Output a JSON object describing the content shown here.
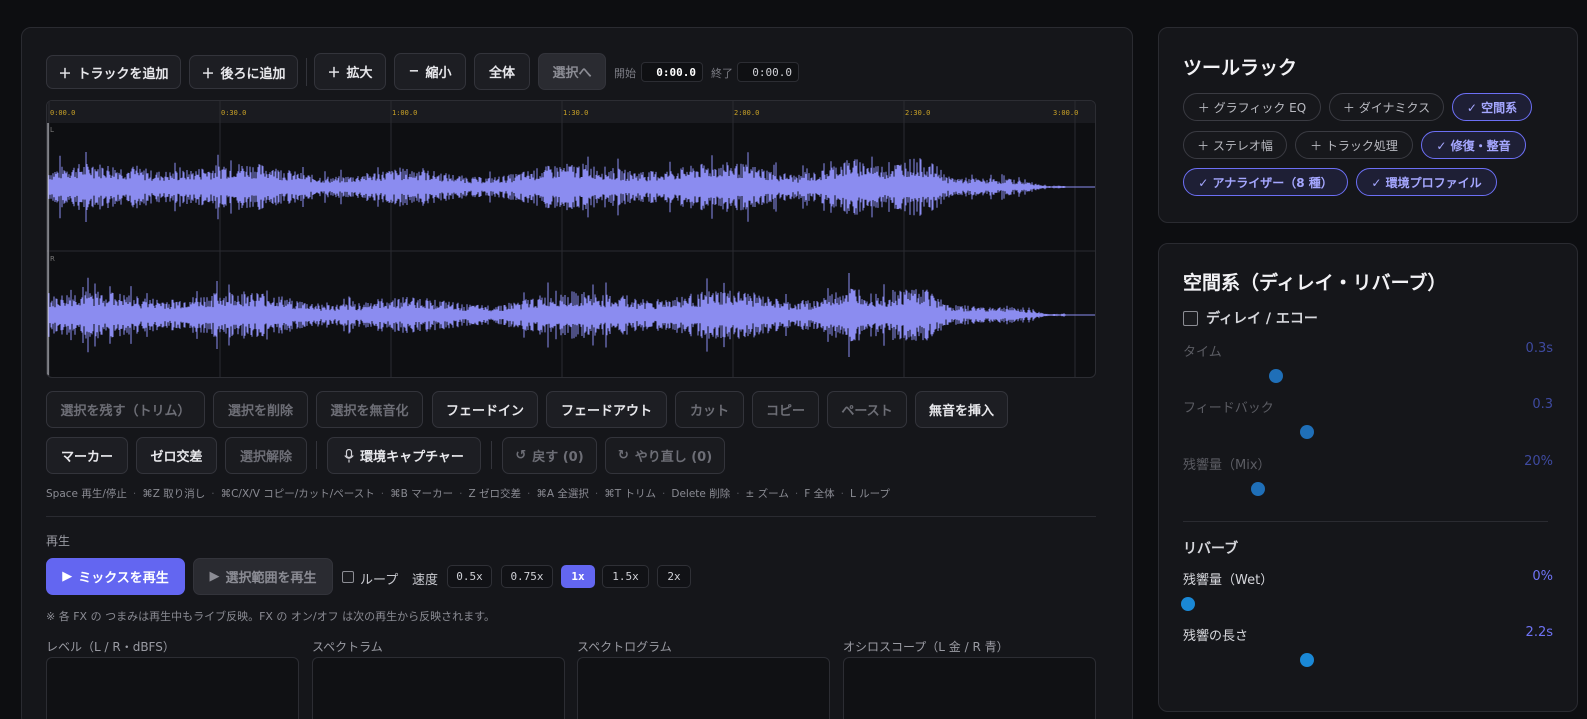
{
  "toolbar": {
    "add_track": "トラックを追加",
    "add_after": "後ろに追加",
    "zoom_in": "拡大",
    "zoom_out": "縮小",
    "fit_all": "全体",
    "to_selection": "選択へ",
    "start_label": "開始",
    "start_value": "0:00.0",
    "end_label": "終了",
    "end_value": "0:00.0"
  },
  "waveform": {
    "time_ticks": [
      "0:00.0",
      "0:30.0",
      "1:00.0",
      "1:30.0",
      "2:00.0",
      "2:30.0",
      "3:00.0"
    ],
    "channel_left": "L",
    "channel_right": "R",
    "wave_color": "#8b8cf0"
  },
  "edit_buttons": {
    "trim": "選択を残す（トリム）",
    "delete": "選択を削除",
    "mute": "選択を無音化",
    "fade_in": "フェードイン",
    "fade_out": "フェードアウト",
    "cut": "カット",
    "copy": "コピー",
    "paste": "ペースト",
    "insert_silence": "無音を挿入",
    "marker": "マーカー",
    "zero_cross": "ゼロ交差",
    "deselect": "選択解除",
    "env_capture": "環境キャプチャー",
    "undo": "戻す (0)",
    "redo": "やり直し (0)"
  },
  "shortcuts": [
    "Space 再生/停止",
    "⌘Z 取り消し",
    "⌘C/X/V コピー/カット/ペースト",
    "⌘B マーカー",
    "Z ゼロ交差",
    "⌘A 全選択",
    "⌘T トリム",
    "Delete 削除",
    "± ズーム",
    "F 全体",
    "L ループ"
  ],
  "playback": {
    "section_label": "再生",
    "play_mix": "ミックスを再生",
    "play_selection": "選択範囲を再生",
    "loop": "ループ",
    "speed_label": "速度",
    "speeds": [
      "0.5x",
      "0.75x",
      "1x",
      "1.5x",
      "2x"
    ],
    "speed_selected": "1x",
    "note": "※ 各 FX の つまみは再生中もライブ反映。FX の オン/オフ は次の再生から反映されます。"
  },
  "visualizers": {
    "level": "レベル（L / R・dBFS）",
    "spectrum": "スペクトラム",
    "spectrogram": "スペクトログラム",
    "oscilloscope": "オシロスコープ（L 金 / R 青）"
  },
  "tool_rack": {
    "title": "ツールラック",
    "chips": [
      {
        "label": "＋ グラフィック EQ",
        "active": false
      },
      {
        "label": "＋ ダイナミクス",
        "active": false
      },
      {
        "label": "✓ 空間系",
        "active": true
      },
      {
        "label": "＋ ステレオ幅",
        "active": false
      },
      {
        "label": "＋ トラック処理",
        "active": false
      },
      {
        "label": "✓ 修復・整音",
        "active": true
      },
      {
        "label": "✓ アナライザー（8 種）",
        "active": true
      },
      {
        "label": "✓ 環境プロファイル",
        "active": true
      }
    ]
  },
  "spatial": {
    "title": "空間系（ディレイ・リバーブ）",
    "delay": {
      "title": "ディレイ / エコー",
      "enabled": false,
      "params": [
        {
          "label": "タイム",
          "value": "0.3s",
          "level": 0.25
        },
        {
          "label": "フィードバック",
          "value": "0.3",
          "level": 0.34
        },
        {
          "label": "残響量（Mix）",
          "value": "20%",
          "level": 0.2
        }
      ]
    },
    "reverb": {
      "title": "リバーブ",
      "params": [
        {
          "label": "残響量（Wet）",
          "value": "0%",
          "level": 0.0
        },
        {
          "label": "残響の長さ",
          "value": "2.2s",
          "level": 0.34
        }
      ]
    }
  }
}
